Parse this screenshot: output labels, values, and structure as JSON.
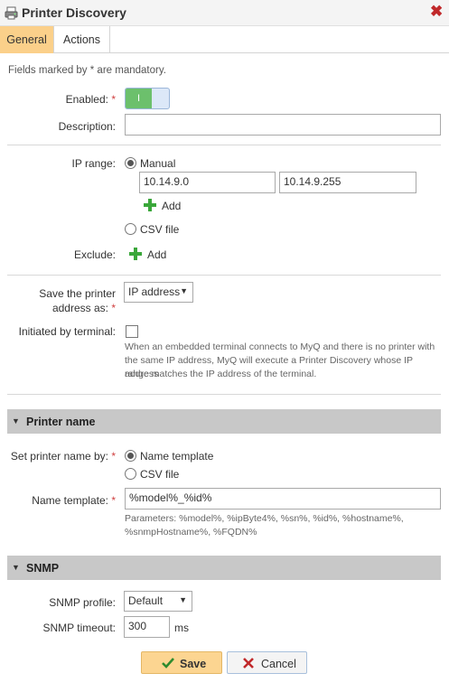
{
  "window": {
    "title": "Printer Discovery",
    "close_icon": "close-icon"
  },
  "tabs": [
    {
      "label": "General",
      "active": true
    },
    {
      "label": "Actions",
      "active": false
    }
  ],
  "form": {
    "mandatory_note": "Fields marked by * are mandatory.",
    "enabled": {
      "label": "Enabled:",
      "required": "*",
      "toggle_text": "I",
      "value": true,
      "accent": "#6cc06c"
    },
    "description": {
      "label": "Description:",
      "value": ""
    },
    "ip_range": {
      "label": "IP range:",
      "options": [
        {
          "label": "Manual",
          "selected": true
        },
        {
          "label": "CSV file",
          "selected": false
        }
      ],
      "from": "10.14.9.0",
      "to": "10.14.9.255",
      "add_label": "Add"
    },
    "exclude": {
      "label": "Exclude:",
      "add_label": "Add"
    },
    "save_address": {
      "label_line1": "Save the printer",
      "label_line2": "address as:",
      "required": "*",
      "value": "IP address"
    },
    "initiated_by_terminal": {
      "label": "Initiated by terminal:",
      "checked": false,
      "help_lines": [
        "When an embedded terminal connects to MyQ and there is no printer with",
        "the same IP address, MyQ will execute a Printer Discovery whose IP address",
        "range matches the IP address of the terminal."
      ]
    }
  },
  "printer_name": {
    "section_title": "Printer name",
    "set_by": {
      "label": "Set printer name by:",
      "required": "*",
      "options": [
        {
          "label": "Name template",
          "selected": true
        },
        {
          "label": "CSV file",
          "selected": false
        }
      ]
    },
    "template": {
      "label": "Name template:",
      "required": "*",
      "value": "%model%_%id%",
      "help_lines": [
        "Parameters: %model%, %ipByte4%, %sn%, %id%, %hostname%,",
        "%snmpHostname%, %FQDN%"
      ]
    }
  },
  "snmp": {
    "section_title": "SNMP",
    "profile": {
      "label": "SNMP profile:",
      "value": "Default"
    },
    "timeout": {
      "label": "SNMP timeout:",
      "value": "300",
      "unit": "ms"
    }
  },
  "buttons": {
    "save": "Save",
    "cancel": "Cancel",
    "save_color": "#fcd591",
    "cancel_icon_color": "#c0282a",
    "check_color": "#2e8b2e"
  }
}
